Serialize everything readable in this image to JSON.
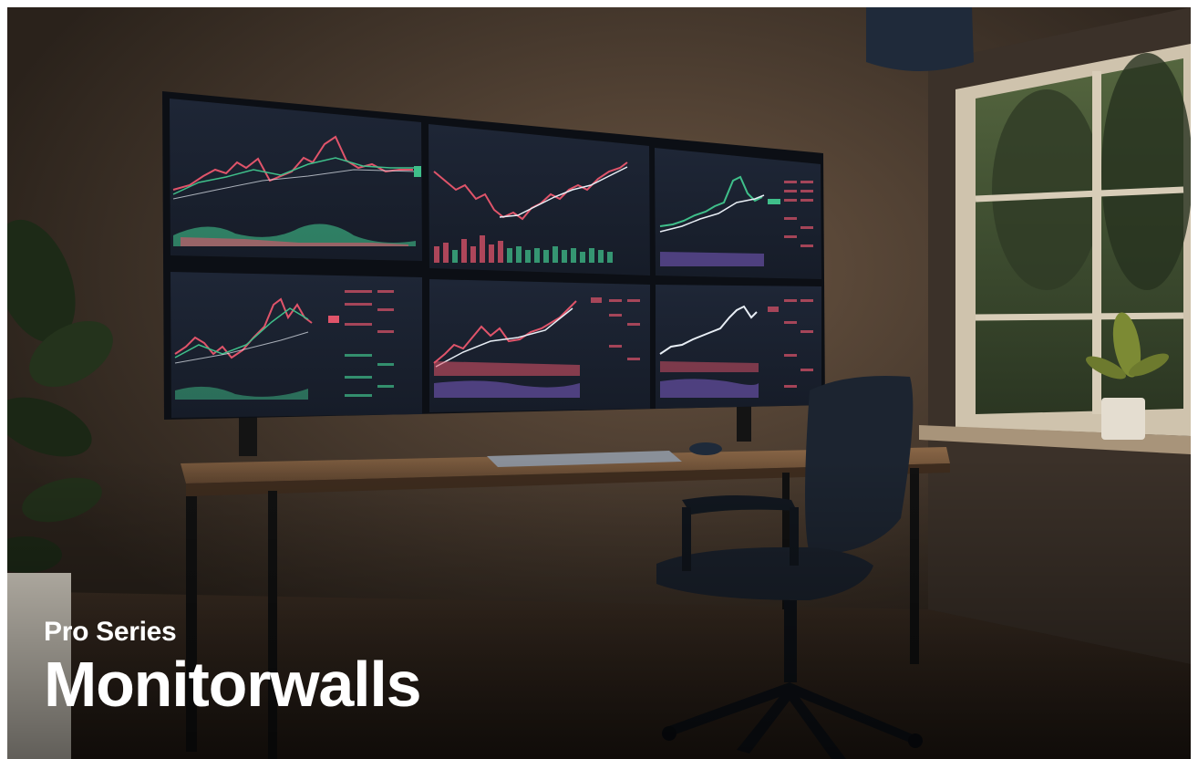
{
  "hero": {
    "eyebrow": "Pro Series",
    "title": "Monitorwalls"
  },
  "colors": {
    "wall": "#4a3b2f",
    "screen_bg": "#1b2230",
    "candle_up": "#3fbf8a",
    "candle_down": "#e0546a",
    "line_white": "#e8eef5",
    "volume_purple": "#7b5cc4",
    "desk_wood": "#7a5a3e",
    "caption_text": "#ffffff"
  }
}
